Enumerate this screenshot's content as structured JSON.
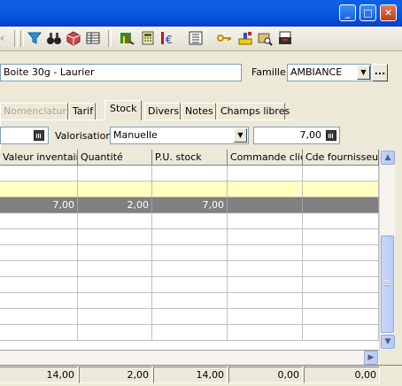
{
  "window": {
    "minimize_icon": "minimize-icon",
    "maximize_icon": "maximize-icon",
    "close_icon": "close-icon"
  },
  "toolbar": {
    "icons": [
      "filter-icon",
      "binoculars-icon",
      "cube-icon",
      "table-icon",
      "chart-icon",
      "calculator-icon",
      "price-euro-icon",
      "grid-icon",
      "key-icon",
      "stamp-icon",
      "folder-search-icon",
      "print-icon"
    ]
  },
  "form": {
    "designation_value": "Boite 30g - Laurier",
    "famille_label": "Famille :",
    "famille_value": "AMBIANCE",
    "more_label": "..."
  },
  "tabs": [
    {
      "label": "Nomenclature",
      "disabled": true
    },
    {
      "label": "Tarif"
    },
    {
      "label": "Stock",
      "active": true
    },
    {
      "label": "Divers"
    },
    {
      "label": "Notes"
    },
    {
      "label": "Champs libres"
    }
  ],
  "stock": {
    "valorisation_label": "Valorisation:",
    "valorisation_value": "Manuelle",
    "amount_value": "7,00"
  },
  "grid": {
    "columns": [
      "Valeur inventaire",
      "Quantité",
      "P.U. stock",
      "Commande client",
      "Cde fournisseur"
    ],
    "rows": [
      [
        "",
        "",
        "",
        "",
        ""
      ],
      [
        "",
        "",
        "",
        "",
        ""
      ],
      [
        "7,00",
        "2,00",
        "7,00",
        "",
        ""
      ],
      [
        "",
        "",
        "",
        "",
        ""
      ],
      [
        "",
        "",
        "",
        "",
        ""
      ],
      [
        "",
        "",
        "",
        "",
        ""
      ],
      [
        "",
        "",
        "",
        "",
        ""
      ],
      [
        "",
        "",
        "",
        "",
        ""
      ],
      [
        "",
        "",
        "",
        "",
        ""
      ],
      [
        "",
        "",
        "",
        "",
        ""
      ],
      [
        "",
        "",
        "",
        "",
        ""
      ]
    ],
    "totals": [
      "14,00",
      "2,00",
      "14,00",
      "0,00",
      "0,00"
    ]
  },
  "colors": {
    "title_bar": "#0a5fe6",
    "selected_row": "#808080",
    "highlight_row": "#ffffc0"
  }
}
